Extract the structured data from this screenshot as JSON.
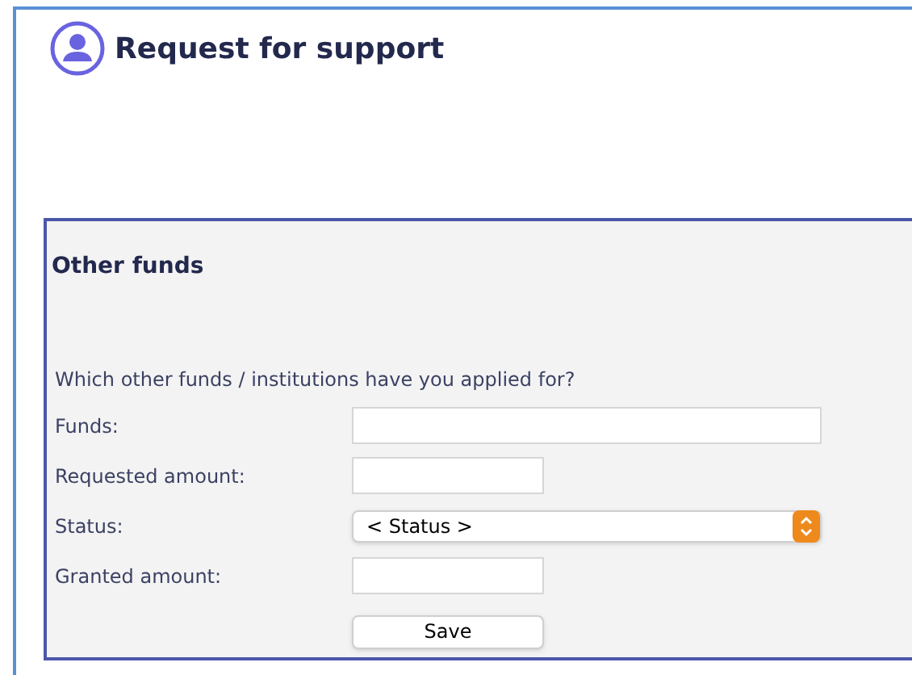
{
  "page": {
    "title": "Request for support"
  },
  "section": {
    "title": "Other funds",
    "question": "Which other funds / institutions have you applied for?",
    "fields": [
      {
        "label": "Funds:",
        "kind": "wide_text"
      },
      {
        "label": "Requested amount:",
        "kind": "short_text"
      },
      {
        "label": "Status:",
        "kind": "select",
        "value": "< Status >"
      },
      {
        "label": "Granted amount:",
        "kind": "short_text"
      }
    ],
    "save_button": "Save"
  }
}
